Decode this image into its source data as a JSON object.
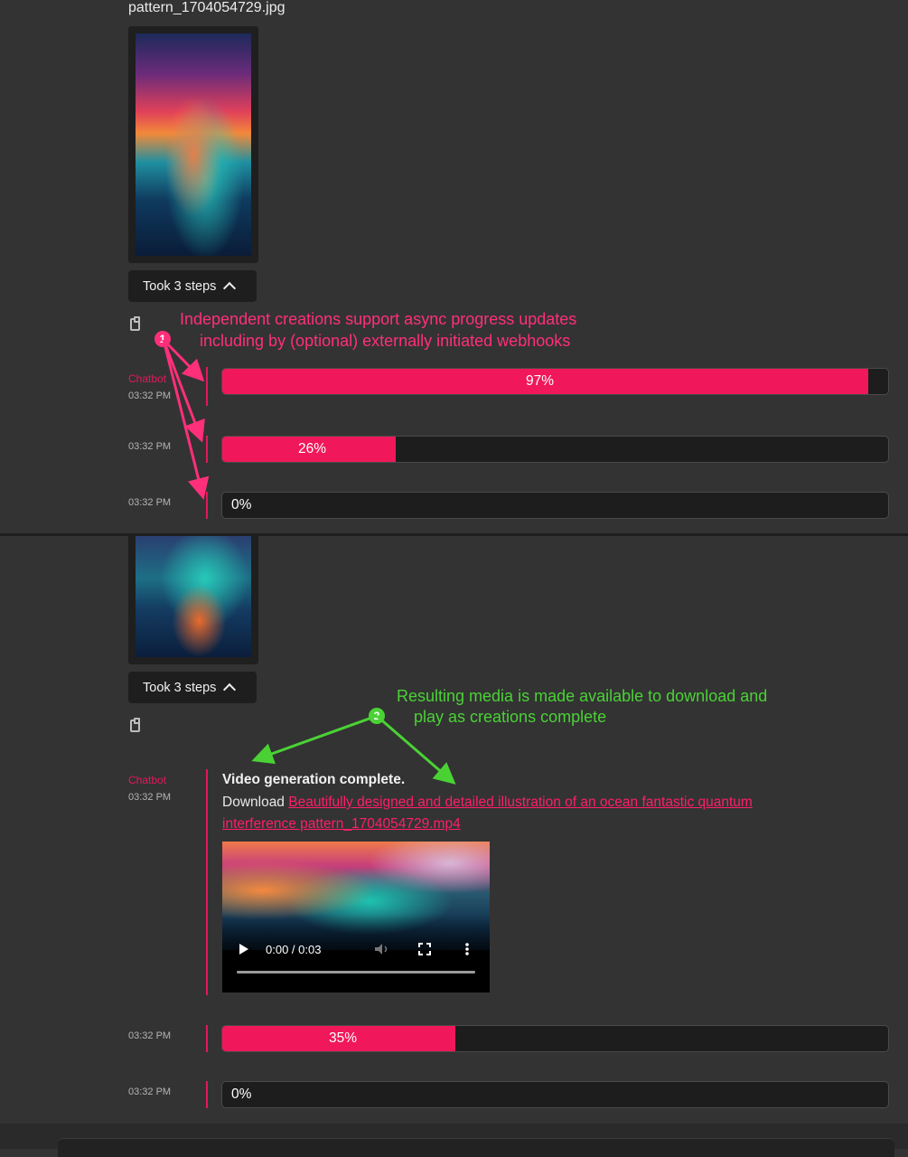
{
  "top": {
    "filename": "pattern_1704054729.jpg",
    "steps_label": "Took 3 steps",
    "annotation_text_line1": "Independent creations support async progress updates",
    "annotation_text_line2": "including by (optional) externally initiated webhooks",
    "annotation_badge": "1",
    "sender": "Chatbot",
    "rows": [
      {
        "time": "03:32 PM",
        "progress": 97,
        "label": "97%"
      },
      {
        "time": "03:32 PM",
        "progress": 26,
        "label": "26%"
      },
      {
        "time": "03:32 PM",
        "progress": 0,
        "label": "0%"
      }
    ]
  },
  "bottom": {
    "steps_label": "Took 3 steps",
    "annotation_text_line1": "Resulting media is made available to download and",
    "annotation_text_line2": "play as creations complete",
    "annotation_badge": "2",
    "sender": "Chatbot",
    "message_time": "03:32 PM",
    "message_title": "Video generation complete.",
    "download_prefix": "Download",
    "download_link_line1": "Beautifully designed and detailed illustration of an ocean fantastic quantum",
    "download_link_line2": "interference pattern_1704054729.mp4",
    "video_time": "0:00 / 0:03",
    "rows": [
      {
        "time": "03:32 PM",
        "progress": 35,
        "label": "35%"
      },
      {
        "time": "03:32 PM",
        "progress": 0,
        "label": "0%"
      }
    ]
  },
  "colors": {
    "accent": "#f0185a",
    "annotation_pink": "#ff2f7a",
    "annotation_green": "#4ad235",
    "background": "#333333"
  },
  "icons": [
    "clipboard-icon",
    "chevron-up-icon",
    "play-icon",
    "volume-icon",
    "fullscreen-icon",
    "more-vertical-icon"
  ]
}
